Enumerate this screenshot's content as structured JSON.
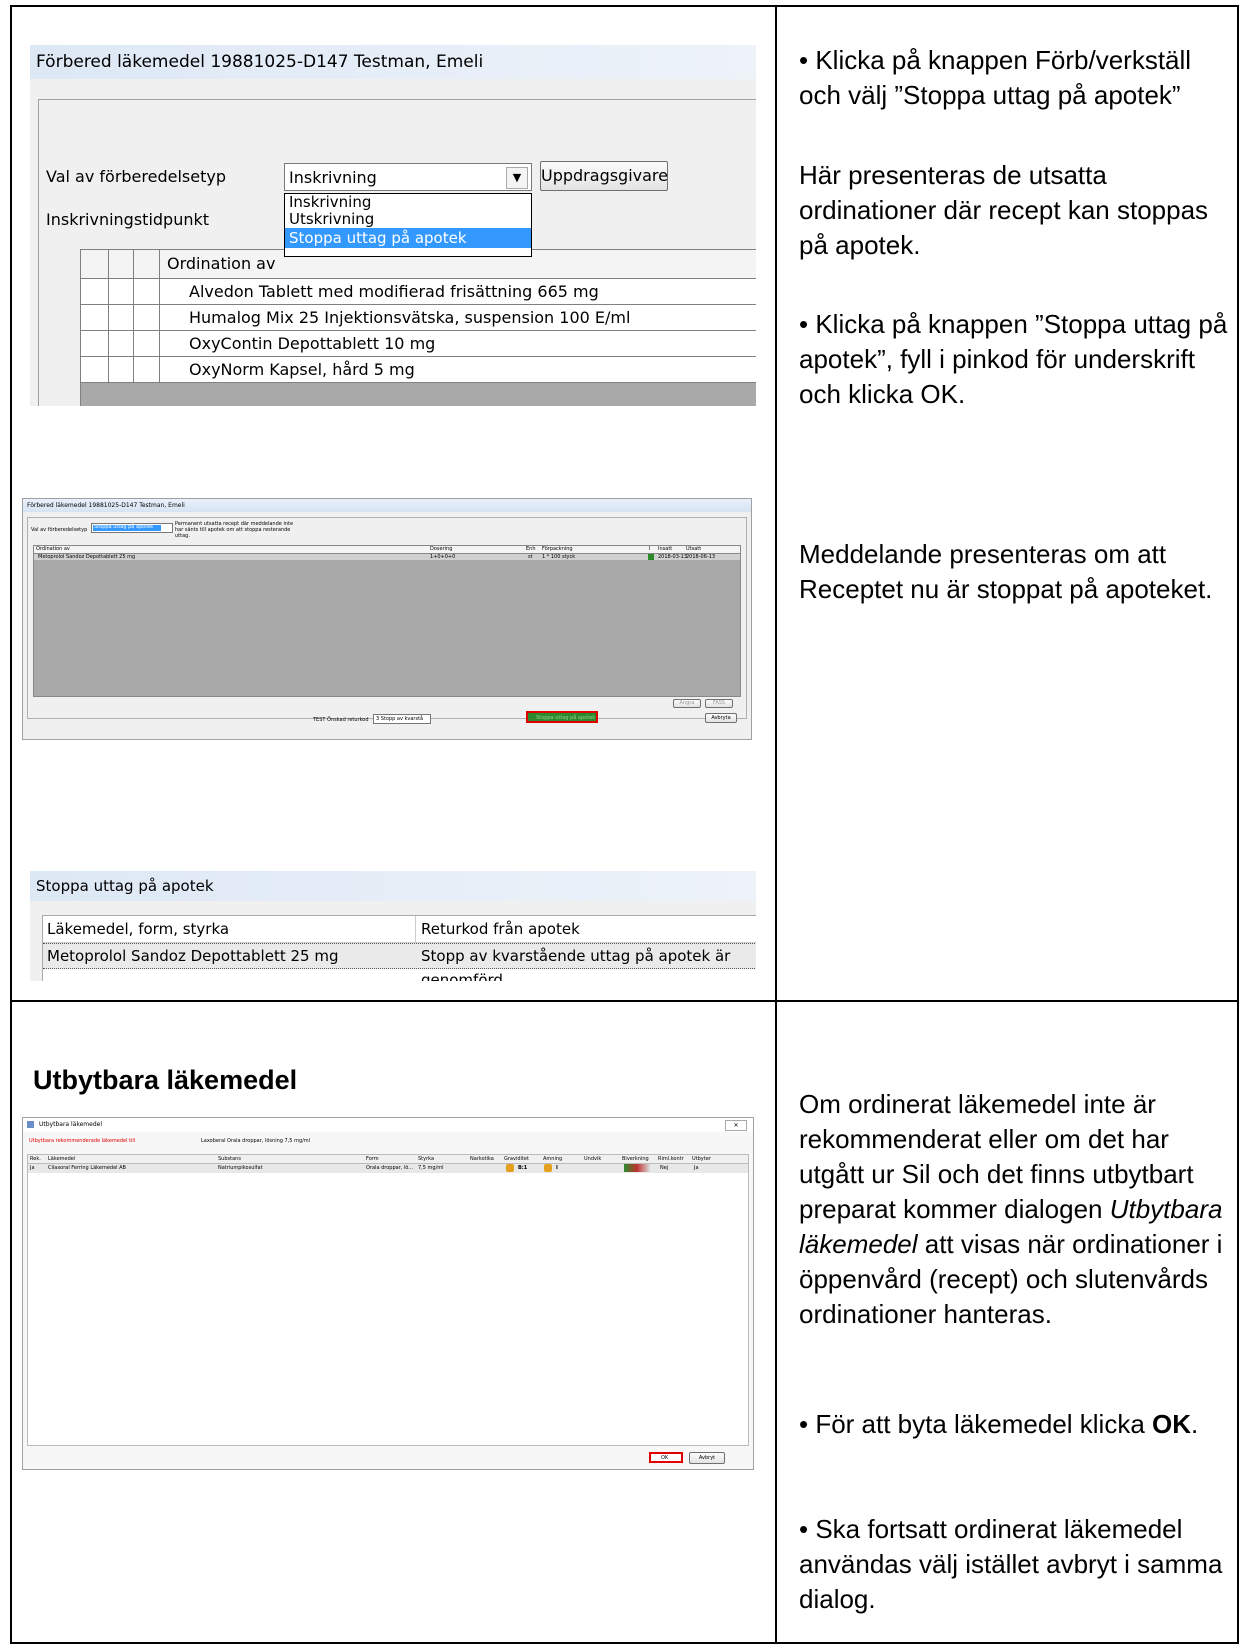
{
  "section1": {
    "window1": {
      "title": "Förbered läkemedel  19881025-D147 Testman, Emeli",
      "val_label": "Val av förberedelsetyp",
      "combo_value": "Inskrivning",
      "uppdrag_button": "Uppdragsgivare",
      "tidpunkt_label": "Inskrivningstidpunkt",
      "dropdown_options": [
        "Inskrivning",
        "Utskrivning",
        "Stoppa uttag på apotek"
      ],
      "column_header": "Ordination av",
      "rows": [
        "Alvedon Tablett med modifierad frisättning 665 mg",
        "Humalog Mix 25 Injektionsvätska, suspension 100 E/ml",
        "OxyContin Depottablett 10 mg",
        "OxyNorm Kapsel, hård 5 mg"
      ]
    },
    "window2": {
      "title": "Förbered läkemedel  19881025-D147 Testman, Emeli",
      "val_label": "Val av förberedelsetyp",
      "combo_value": "Stoppa uttag på apotek",
      "info": "Permanent utsatta recept där meddelande inte har sänts till apotek om att stoppa resterande uttag.",
      "headers": [
        "Ordination av",
        "Dosering",
        "Enh",
        "Förpackning",
        "I",
        "Insatt",
        "Utsatt"
      ],
      "row": [
        "Metoprolol Sandoz Depottablett 25 mg",
        "1+0+0+0",
        "st",
        "1 * 100 styck",
        "",
        "2018-03-13",
        "2018-06-13"
      ],
      "angre": "Ångra",
      "fass": "FASS",
      "returkod_label": "TEST Önskad returkod",
      "returkod_value": "3 Stopp av kvarstå",
      "stoppa_button": "Stoppa uttag på apotek",
      "avbryt": "Avbryta"
    },
    "window3": {
      "title": "Stoppa uttag på apotek",
      "headers": [
        "Läkemedel, form, styrka",
        "Returkod från apotek"
      ],
      "row": [
        "Metoprolol Sandoz Depottablett 25 mg",
        "Stopp av kvarstående uttag på apotek är genomförd."
      ]
    },
    "text": [
      "• Klicka på knappen Förb/verkställ och välj ”Stoppa uttag på apotek”",
      "Här presenteras de utsatta ordinationer där recept kan stoppas på apotek.",
      "• Klicka på knappen ”Stoppa uttag på apotek”, fyll i pinkod för underskrift och klicka OK.",
      "Meddelande presenteras om att Receptet nu är stoppat på apoteket."
    ]
  },
  "section2": {
    "heading": "Utbytbara läkemedel",
    "window": {
      "title": "Utbytbara läkemedel",
      "recommend_label": "Utbytbara rekommenderade läkemedel till",
      "recommend_value": "Laxoberal Orala droppar, lösning 7,5 mg/ml",
      "headers": [
        "Rek.",
        "Läkemedel",
        "Substans",
        "Form",
        "Styrka",
        "Narkotika",
        "Graviditet",
        "Amning",
        "Undvik",
        "Biverkning",
        "Riml.kontr",
        "Utbyter"
      ],
      "row": [
        "Ja",
        "Cilaxoral Ferring Läkemedel AB",
        "Natriumpikosulfat",
        "Orala droppar, lö...",
        "7,5 mg/ml",
        "",
        "B:1",
        "I",
        "",
        "",
        "Nej",
        "Ja"
      ],
      "ok": "OK",
      "avbryt": "Avbryt"
    },
    "text_p1_before": "Om ordinerat läkemedel inte är rekommenderat eller om det har utgått ur Sil och det finns utbytbart preparat kommer dialogen ",
    "text_p1_italic": "Utbytbara läkemedel",
    "text_p1_after": " att visas när ordinationer i öppenvård (recept) och slutenvårds ordinationer hanteras.",
    "text_p2_before": "• För att byta läkemedel klicka ",
    "text_p2_bold": "OK",
    "text_p2_after": ".",
    "text_p3": "• Ska fortsatt ordinerat läkemedel användas välj istället avbryt i samma dialog."
  }
}
